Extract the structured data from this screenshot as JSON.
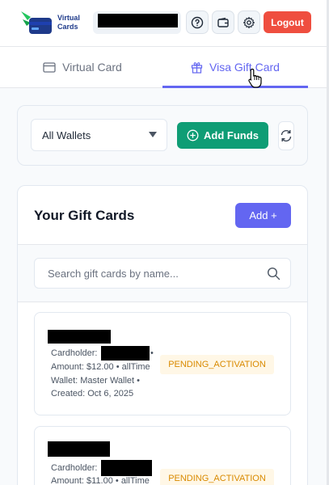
{
  "header": {
    "brand_line1": "Virtual",
    "brand_line2": "Cards",
    "icons": [
      "help-circle-icon",
      "wallet-icon",
      "gear-icon"
    ],
    "logout_label": "Logout",
    "colors": {
      "logout": "#ef4e3f",
      "brand": "#1e3a8a",
      "logo_green": "#22c55e"
    }
  },
  "tabs": [
    {
      "label": "Virtual Card",
      "icon": "credit-card-icon",
      "active": false
    },
    {
      "label": "Visa Gift Card",
      "icon": "gift-icon",
      "active": true
    }
  ],
  "filters": {
    "wallet_select": "All Wallets",
    "add_funds_label": "Add Funds",
    "refresh_icon": "refresh-icon"
  },
  "gift_cards": {
    "title": "Your Gift Cards",
    "add_label": "Add +",
    "search_placeholder": "Search gift cards by name...",
    "items": [
      {
        "cardholder_label": "Cardholder:",
        "amount_line": "Amount: $12.00 • allTime",
        "wallet_line": "Wallet: Master Wallet •",
        "created_line": "Created: Oct 6, 2025",
        "status": "PENDING_ACTIVATION"
      },
      {
        "cardholder_label": "Cardholder:",
        "amount_line": "Amount: $11.00 • allTime",
        "status": "PENDING_ACTIVATION"
      }
    ]
  },
  "accent_colors": {
    "primary": "#6366f1",
    "success": "#0f9d75",
    "status_pending": "#d98a00"
  }
}
